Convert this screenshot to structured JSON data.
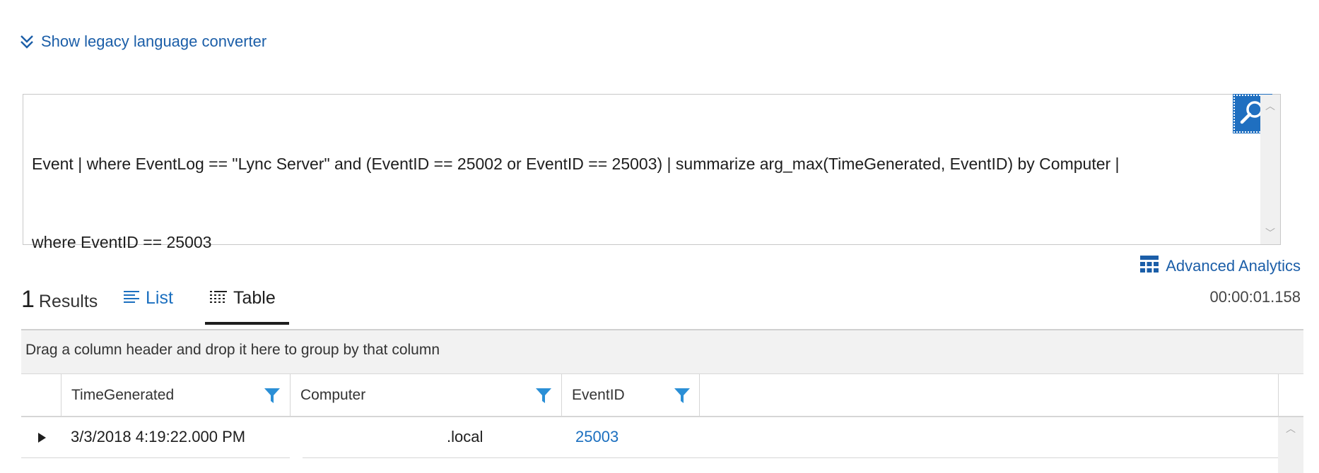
{
  "legacy": {
    "label": "Show legacy language converter",
    "icon": "double-chevron-down-icon"
  },
  "query": {
    "line1": "Event | where EventLog == \"Lync Server\" and (EventID == 25002 or EventID == 25003) | summarize arg_max(TimeGenerated, EventID) by Computer |",
    "line2": "where EventID == 25003"
  },
  "search_button": {
    "icon": "search-icon"
  },
  "advanced_analytics": {
    "label": "Advanced Analytics",
    "icon": "analytics-grid-icon"
  },
  "results": {
    "count": "1",
    "label": "Results"
  },
  "tabs": [
    {
      "label": "List",
      "icon": "list-icon"
    },
    {
      "label": "Table",
      "icon": "table-icon"
    }
  ],
  "duration": "00:00:01.158",
  "grid": {
    "group_hint": "Drag a column header and drop it here to group by that column",
    "columns": [
      {
        "label": "TimeGenerated"
      },
      {
        "label": "Computer"
      },
      {
        "label": "EventID"
      }
    ],
    "rows": [
      {
        "time": "3/3/2018 4:19:22.000 PM",
        "computer": ".local",
        "eventid": "25003"
      }
    ]
  },
  "colors": {
    "accent": "#1b6fbf",
    "link": "#1b5ea8",
    "search_button": "#1f6fc0",
    "filter_icon": "#2b8fd6"
  }
}
